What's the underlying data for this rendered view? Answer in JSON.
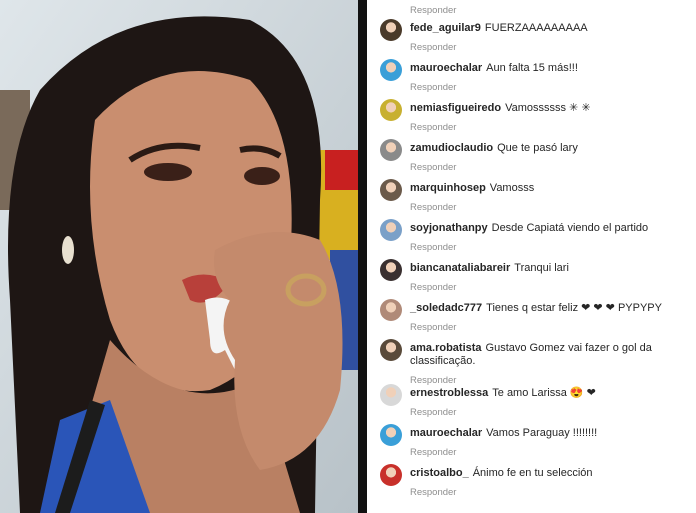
{
  "reply_label": "Responder",
  "comments": [
    {
      "username": "fede_aguilar9",
      "text": "FUERZAAAAAAAAA",
      "avatar_color": "#4a3a2a"
    },
    {
      "username": "mauroechalar",
      "text": "Aun falta 15 más!!!",
      "avatar_color": "#3a9fd8"
    },
    {
      "username": "nemiasfigueiredo",
      "text": "Vamossssss ✳ ✳",
      "avatar_color": "#c8b030"
    },
    {
      "username": "zamudioclaudio",
      "text": "Que te pasó lary",
      "avatar_color": "#8a8a8a"
    },
    {
      "username": "marquinhosep",
      "text": "Vamosss",
      "avatar_color": "#6b5a4a"
    },
    {
      "username": "soyjonathanpy",
      "text": "Desde Capiatá viendo el partido",
      "avatar_color": "#7aa0c8"
    },
    {
      "username": "biancanataliabareir",
      "text": "Tranqui lari",
      "avatar_color": "#3a3030"
    },
    {
      "username": "_soledadc777",
      "text": "Tienes q estar feliz ❤ ❤ ❤ PYPYPY",
      "avatar_color": "#b08a78"
    },
    {
      "username": "ama.robatista",
      "text": "Gustavo Gomez vai fazer o gol da classificação.",
      "avatar_color": "#5a4a3a"
    },
    {
      "username": "ernestroblessa",
      "text": "Te amo Larissa 😍 ❤",
      "avatar_color": "#d8d8d8"
    },
    {
      "username": "mauroechalar",
      "text": "Vamos Paraguay !!!!!!!!",
      "avatar_color": "#3a9fd8"
    },
    {
      "username": "cristoalbo_",
      "text": "Ánimo fe en tu selección",
      "avatar_color": "#c8302a"
    }
  ]
}
